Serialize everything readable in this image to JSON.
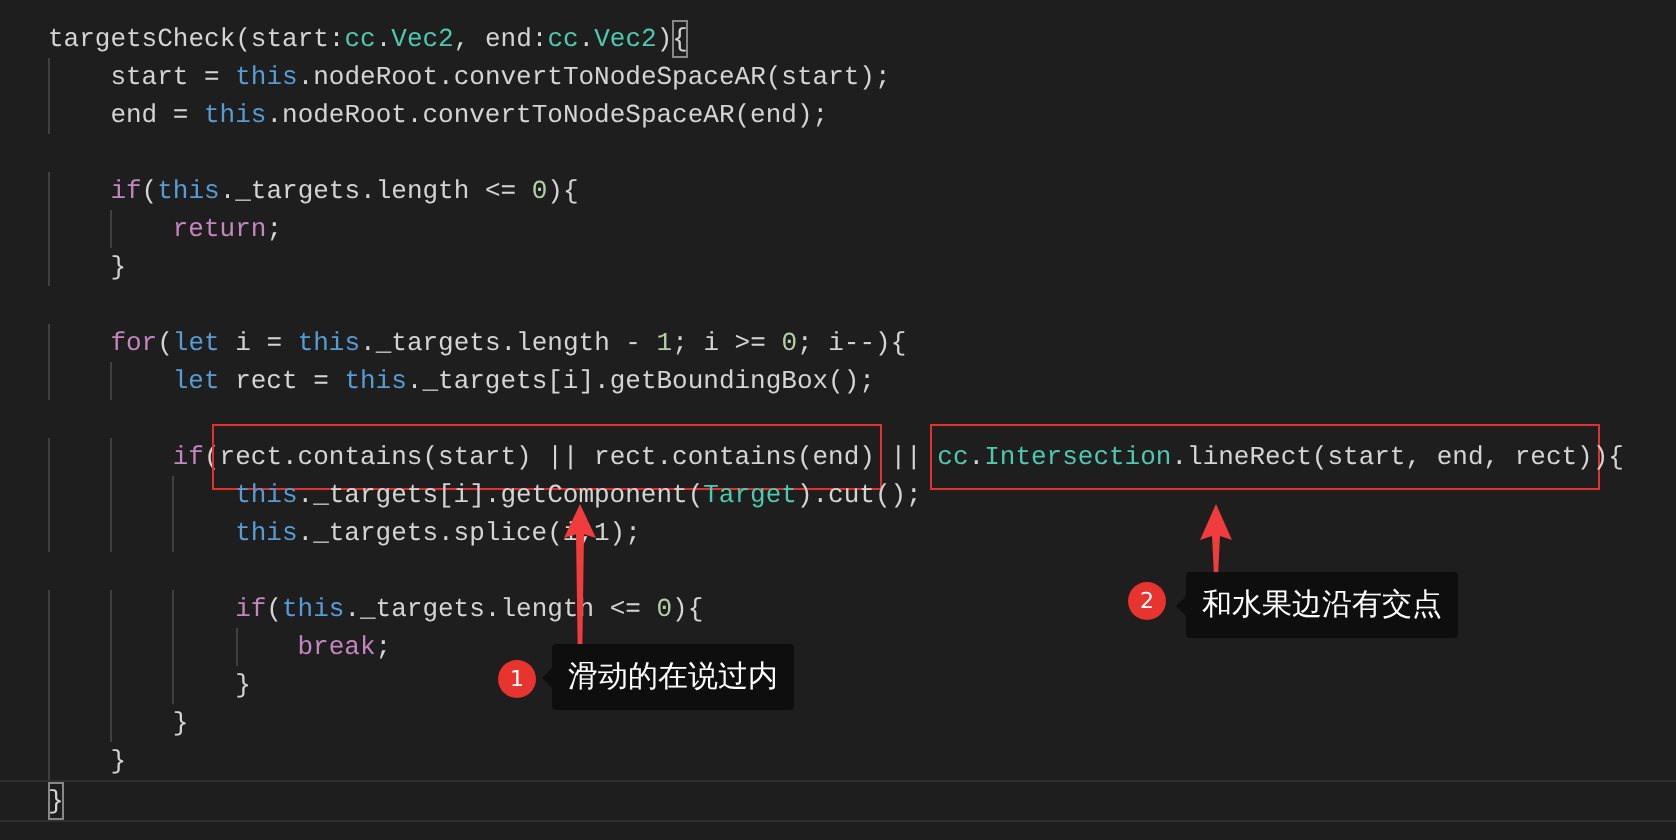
{
  "editor": {
    "lines": [
      {
        "kind": "code",
        "tokens": [
          {
            "kind": "plain",
            "text": "targetsCheck(start:"
          },
          {
            "kind": "type",
            "text": "cc"
          },
          {
            "kind": "plain",
            "text": "."
          },
          {
            "kind": "type",
            "text": "Vec2"
          },
          {
            "kind": "plain",
            "text": ", end:"
          },
          {
            "kind": "type",
            "text": "cc"
          },
          {
            "kind": "plain",
            "text": "."
          },
          {
            "kind": "type",
            "text": "Vec2"
          },
          {
            "kind": "plain",
            "text": ")"
          },
          {
            "kind": "match",
            "text": "{"
          }
        ]
      },
      {
        "kind": "code",
        "tokens": [
          {
            "kind": "plain",
            "text": "    start = "
          },
          {
            "kind": "this",
            "text": "this"
          },
          {
            "kind": "plain",
            "text": ".nodeRoot.convertToNodeSpaceAR(start);"
          }
        ]
      },
      {
        "kind": "code",
        "tokens": [
          {
            "kind": "plain",
            "text": "    end = "
          },
          {
            "kind": "this",
            "text": "this"
          },
          {
            "kind": "plain",
            "text": ".nodeRoot.convertToNodeSpaceAR(end);"
          }
        ]
      },
      {
        "kind": "blank"
      },
      {
        "kind": "code",
        "tokens": [
          {
            "kind": "kw",
            "text": "    if"
          },
          {
            "kind": "plain",
            "text": "("
          },
          {
            "kind": "this",
            "text": "this"
          },
          {
            "kind": "plain",
            "text": "._targets.length <= "
          },
          {
            "kind": "num",
            "text": "0"
          },
          {
            "kind": "plain",
            "text": "){"
          }
        ]
      },
      {
        "kind": "code",
        "tokens": [
          {
            "kind": "kw",
            "text": "        return"
          },
          {
            "kind": "plain",
            "text": ";"
          }
        ]
      },
      {
        "kind": "code",
        "tokens": [
          {
            "kind": "plain",
            "text": "    }"
          }
        ]
      },
      {
        "kind": "blank"
      },
      {
        "kind": "code",
        "tokens": [
          {
            "kind": "kw",
            "text": "    for"
          },
          {
            "kind": "plain",
            "text": "("
          },
          {
            "kind": "this",
            "text": "let"
          },
          {
            "kind": "plain",
            "text": " i = "
          },
          {
            "kind": "this",
            "text": "this"
          },
          {
            "kind": "plain",
            "text": "._targets.length - "
          },
          {
            "kind": "num",
            "text": "1"
          },
          {
            "kind": "plain",
            "text": "; i >= "
          },
          {
            "kind": "num",
            "text": "0"
          },
          {
            "kind": "plain",
            "text": "; i--){"
          }
        ]
      },
      {
        "kind": "code",
        "tokens": [
          {
            "kind": "this",
            "text": "        let"
          },
          {
            "kind": "plain",
            "text": " rect = "
          },
          {
            "kind": "this",
            "text": "this"
          },
          {
            "kind": "plain",
            "text": "._targets[i].getBoundingBox();"
          }
        ]
      },
      {
        "kind": "blank"
      },
      {
        "kind": "code",
        "tokens": [
          {
            "kind": "kw",
            "text": "        if"
          },
          {
            "kind": "plain",
            "text": "("
          },
          {
            "kind": "group",
            "framed": true,
            "tokens": [
              {
                "kind": "plain",
                "text": "rect.contains(start) || rect.contains(end)"
              }
            ]
          },
          {
            "kind": "plain",
            "text": " || "
          },
          {
            "kind": "group",
            "framed": true,
            "tokens": [
              {
                "kind": "type",
                "text": "cc"
              },
              {
                "kind": "plain",
                "text": "."
              },
              {
                "kind": "type",
                "text": "Intersection"
              },
              {
                "kind": "plain",
                "text": ".lineRect(start, end, rect)"
              }
            ]
          },
          {
            "kind": "plain",
            "text": "){"
          }
        ]
      },
      {
        "kind": "code",
        "tokens": [
          {
            "kind": "this",
            "text": "            this"
          },
          {
            "kind": "plain",
            "text": "._targets[i].getComponent("
          },
          {
            "kind": "type",
            "text": "Target"
          },
          {
            "kind": "plain",
            "text": ").cut();"
          }
        ]
      },
      {
        "kind": "code",
        "tokens": [
          {
            "kind": "this",
            "text": "            this"
          },
          {
            "kind": "plain",
            "text": "._targets.splice(i,1);"
          }
        ]
      },
      {
        "kind": "blank"
      },
      {
        "kind": "code",
        "tokens": [
          {
            "kind": "kw",
            "text": "            if"
          },
          {
            "kind": "plain",
            "text": "("
          },
          {
            "kind": "this",
            "text": "this"
          },
          {
            "kind": "plain",
            "text": "._targets.length <= "
          },
          {
            "kind": "num",
            "text": "0"
          },
          {
            "kind": "plain",
            "text": "){"
          }
        ]
      },
      {
        "kind": "code",
        "tokens": [
          {
            "kind": "kw",
            "text": "                break"
          },
          {
            "kind": "plain",
            "text": ";"
          }
        ]
      },
      {
        "kind": "code",
        "tokens": [
          {
            "kind": "plain",
            "text": "            }"
          }
        ]
      },
      {
        "kind": "code",
        "tokens": [
          {
            "kind": "plain",
            "text": "        }"
          }
        ]
      },
      {
        "kind": "code",
        "tokens": [
          {
            "kind": "plain",
            "text": "    }"
          }
        ]
      },
      {
        "kind": "code",
        "current": true,
        "tokens": [
          {
            "kind": "match",
            "text": "}"
          }
        ]
      }
    ]
  },
  "annotations": [
    {
      "number": "1",
      "text": "滑动的在说过内"
    },
    {
      "number": "2",
      "text": "和水果边沿有交点"
    }
  ]
}
